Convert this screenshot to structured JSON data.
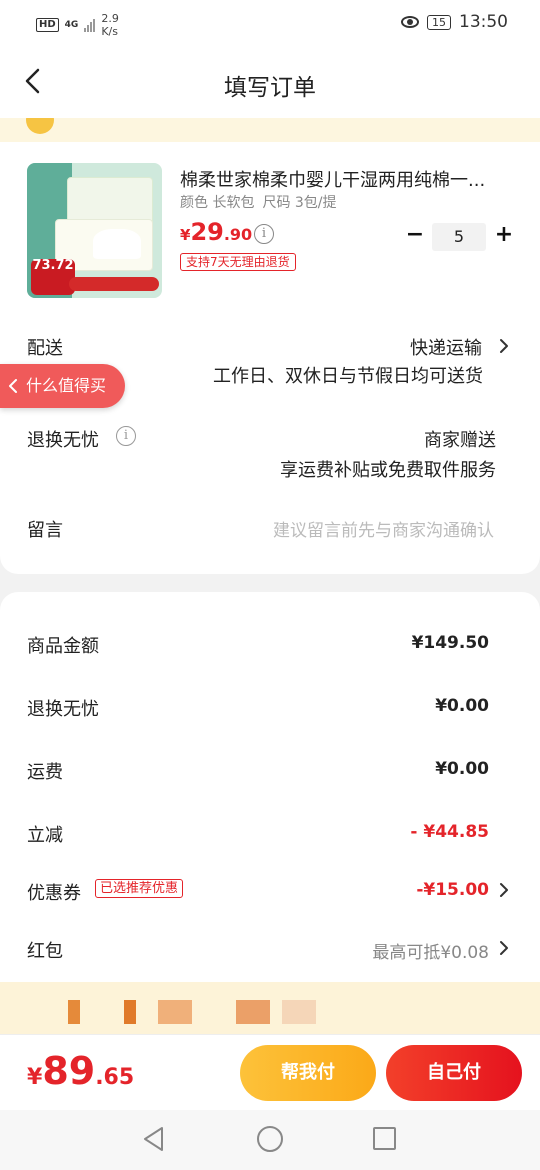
{
  "status_bar": {
    "hd": "HD",
    "network": "4G",
    "speed_value": "2.9",
    "speed_unit": "K/s",
    "battery": "15",
    "time": "13:50"
  },
  "header": {
    "title": "填写订单"
  },
  "product": {
    "title": "棉柔世家棉柔巾婴儿干湿两用纯棉一...",
    "color_spec": "颜色 长软包",
    "size_spec": "尺码 3包/提",
    "price_symbol": "¥",
    "price_int": "29",
    "price_dec": ".90",
    "return_tag": "支持7天无理由退货",
    "quantity": "5",
    "image_badge_value": "73.72"
  },
  "delivery": {
    "label": "配送",
    "method": "快递运输",
    "note": "工作日、双休日与节假日均可送货"
  },
  "floating_button": {
    "label": "什么值得买"
  },
  "return_worry_free": {
    "label": "退换无忧",
    "value": "商家赠送",
    "note": "享运费补贴或免费取件服务"
  },
  "message": {
    "label": "留言",
    "placeholder": "建议留言前先与商家沟通确认"
  },
  "summary": {
    "goods_amount_label": "商品金额",
    "goods_amount_value": "¥149.50",
    "return_label": "退换无忧",
    "return_value": "¥0.00",
    "shipping_label": "运费",
    "shipping_value": "¥0.00",
    "discount_label": "立减",
    "discount_value": "- ¥44.85",
    "coupon_label": "优惠券",
    "coupon_tag": "已选推荐优惠",
    "coupon_value": "-¥15.00",
    "redpacket_label": "红包",
    "redpacket_value": "最高可抵¥0.08"
  },
  "pay_bar": {
    "total_symbol": "¥",
    "total_int": "89",
    "total_dec": ".65",
    "help_pay_label": "帮我付",
    "self_pay_label": "自己付"
  },
  "colors": {
    "accent_red": "#e4242a",
    "accent_orange": "#fba918",
    "notice_bg": "#fdf6df"
  },
  "icons": {
    "back": "chevron-left-icon",
    "info": "info-icon",
    "chevron": "chevron-right-icon",
    "nav_back": "triangle-back-icon",
    "nav_home": "circle-home-icon",
    "nav_recent": "square-recent-icon"
  }
}
